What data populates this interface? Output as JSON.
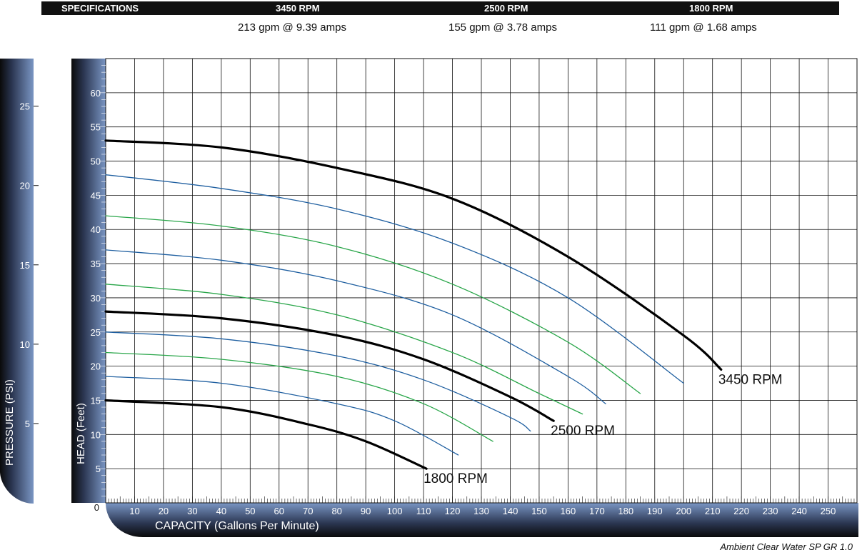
{
  "specs": {
    "title": "SPECIFICATIONS",
    "columns": [
      {
        "rpm": "3450 RPM",
        "value": "213 gpm @ 9.39 amps"
      },
      {
        "rpm": "2500 RPM",
        "value": "155 gpm @ 3.78 amps"
      },
      {
        "rpm": "1800 RPM",
        "value": "111 gpm @ 1.68 amps"
      }
    ]
  },
  "footer_note": "Ambient Clear Water SP GR 1.0",
  "colors": {
    "main_curve": "#000000",
    "blue_curve": "#1f5fa0",
    "green_curve": "#2aa64a",
    "band_light": "#7a96c4",
    "band_dark": "#0a0a0a",
    "grid": "#111111"
  },
  "chart_data": {
    "type": "line",
    "xlabel": "CAPACITY (Gallons Per Minute)",
    "ylabel": "HEAD (Feet)",
    "y2label": "PRESSURE (PSI)",
    "xlim": [
      0,
      260
    ],
    "ylim": [
      0,
      65
    ],
    "y2lim": [
      0,
      28
    ],
    "x_ticks": [
      10,
      20,
      30,
      40,
      50,
      60,
      70,
      80,
      90,
      100,
      110,
      120,
      130,
      140,
      150,
      160,
      170,
      180,
      190,
      200,
      210,
      220,
      230,
      240,
      250
    ],
    "y_ticks": [
      0,
      5,
      10,
      15,
      20,
      25,
      30,
      35,
      40,
      45,
      50,
      55,
      60
    ],
    "y2_ticks": [
      5,
      10,
      15,
      20,
      25
    ],
    "grid": true,
    "series": [
      {
        "name": "3450 RPM",
        "style": "main",
        "x": [
          0,
          40,
          80,
          120,
          160,
          200,
          213
        ],
        "y": [
          53,
          52,
          49,
          44.5,
          36,
          24.5,
          19.5
        ]
      },
      {
        "name": "",
        "style": "blue",
        "x": [
          0,
          40,
          80,
          120,
          160,
          200
        ],
        "y": [
          48,
          46,
          43,
          38,
          30,
          17.5
        ]
      },
      {
        "name": "",
        "style": "green",
        "x": [
          0,
          40,
          80,
          120,
          160,
          185
        ],
        "y": [
          42,
          40.5,
          37.5,
          32,
          23.5,
          16
        ]
      },
      {
        "name": "",
        "style": "blue",
        "x": [
          0,
          40,
          80,
          120,
          160,
          173
        ],
        "y": [
          37,
          35.5,
          32.5,
          27.5,
          18.5,
          14.5
        ]
      },
      {
        "name": "",
        "style": "green",
        "x": [
          0,
          40,
          80,
          120,
          150,
          165
        ],
        "y": [
          32,
          30.5,
          27.5,
          22,
          16,
          13
        ]
      },
      {
        "name": "2500 RPM",
        "style": "main",
        "x": [
          0,
          40,
          80,
          110,
          140,
          155
        ],
        "y": [
          28,
          27,
          24.5,
          21,
          15.5,
          12
        ]
      },
      {
        "name": "",
        "style": "blue",
        "x": [
          0,
          40,
          80,
          110,
          140,
          147
        ],
        "y": [
          25,
          24,
          21.5,
          18,
          12.5,
          10.5
        ]
      },
      {
        "name": "",
        "style": "green",
        "x": [
          0,
          40,
          80,
          110,
          134
        ],
        "y": [
          22,
          21,
          18.5,
          14.5,
          9
        ]
      },
      {
        "name": "",
        "style": "blue",
        "x": [
          0,
          40,
          80,
          100,
          122
        ],
        "y": [
          18.5,
          17.5,
          14.5,
          12,
          7
        ]
      },
      {
        "name": "1800 RPM",
        "style": "main",
        "x": [
          0,
          40,
          70,
          90,
          111
        ],
        "y": [
          15,
          14,
          11.5,
          9,
          5
        ]
      }
    ]
  }
}
